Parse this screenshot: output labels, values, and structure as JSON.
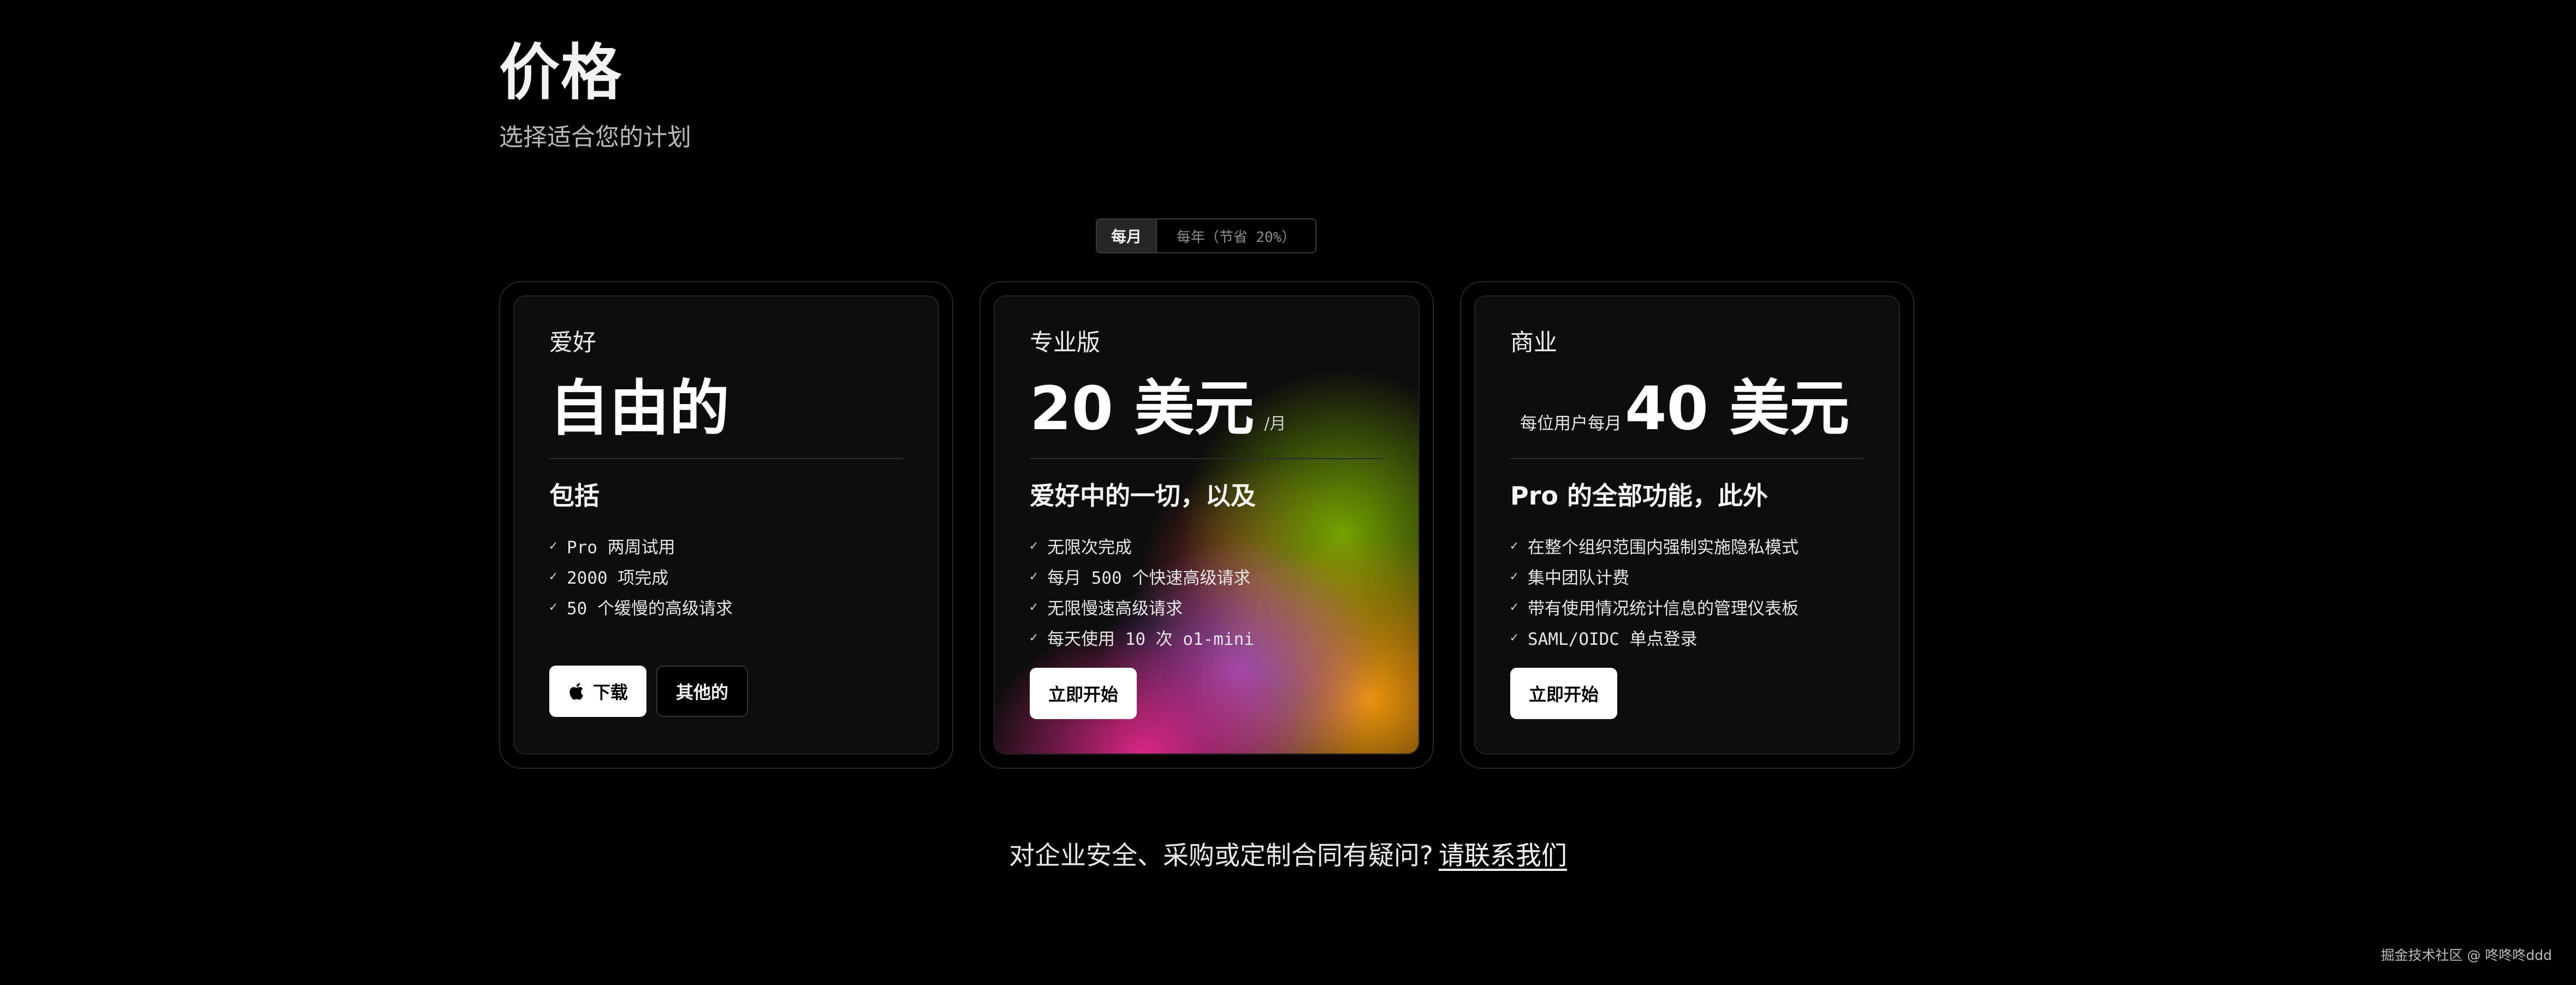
{
  "header": {
    "title": "价格",
    "subtitle": "选择适合您的计划"
  },
  "billing_toggle": {
    "monthly": "每月",
    "yearly": "每年（节省 20%）",
    "selected": "每月"
  },
  "plans": [
    {
      "name": "爱好",
      "price_prefix": "",
      "price": "自由的",
      "price_suffix": "",
      "includes_title": "包括",
      "features": [
        "Pro 两周试用",
        "2000 项完成",
        "50 个缓慢的高级请求"
      ],
      "buttons": [
        "下载",
        "其他的"
      ]
    },
    {
      "name": "专业版",
      "price_prefix": "",
      "price": "20 美元",
      "price_suffix": "/月",
      "includes_title": "爱好中的一切，以及",
      "features": [
        "无限次完成",
        "每月 500 个快速高级请求",
        "无限慢速高级请求",
        "每天使用 10 次 o1-mini"
      ],
      "buttons": [
        "立即开始"
      ]
    },
    {
      "name": "商业",
      "price_prefix": "每位用户每月",
      "price": "40 美元",
      "price_suffix": "",
      "includes_title": "Pro 的全部功能，此外",
      "features": [
        "在整个组织范围内强制实施隐私模式",
        "集中团队计费",
        "带有使用情况统计信息的管理仪表板",
        "SAML/OIDC 单点登录"
      ],
      "buttons": [
        "立即开始"
      ]
    }
  ],
  "footer": {
    "contact_text": "对企业安全、采购或定制合同有疑问?",
    "contact_link": "请联系我们"
  },
  "watermark": "掘金技术社区 @ 咚咚咚ddd",
  "icons": {
    "check": "check-icon",
    "apple": "apple-icon"
  },
  "colors": {
    "background": "#000000",
    "card": "#0d0d0d",
    "primary_button": "#ffffff"
  }
}
